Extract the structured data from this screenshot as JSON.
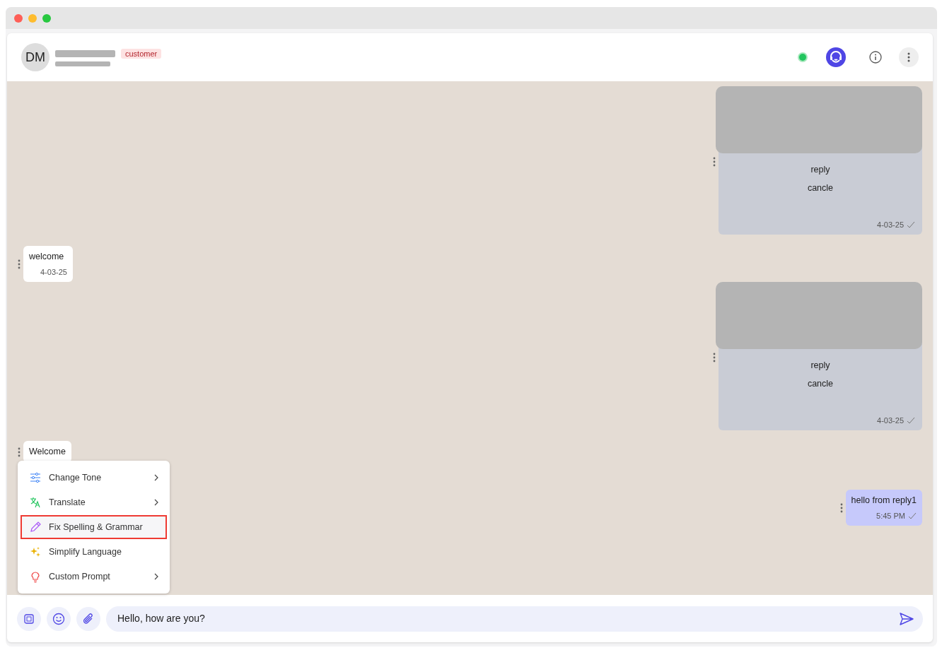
{
  "header": {
    "avatar_initials": "DM",
    "tag": "customer",
    "online": true
  },
  "messages": [
    {
      "kind": "template",
      "outgoing": true,
      "buttons": [
        "reply",
        "cancle"
      ],
      "time": "4-03-25"
    },
    {
      "kind": "text",
      "outgoing": false,
      "text": "welcome",
      "time": "4-03-25"
    },
    {
      "kind": "template",
      "outgoing": true,
      "buttons": [
        "reply",
        "cancle"
      ],
      "time": "4-03-25"
    },
    {
      "kind": "text",
      "outgoing": false,
      "text": "Welcome"
    },
    {
      "kind": "text",
      "outgoing": true,
      "text": "hello from reply1",
      "time": "5:45 PM"
    }
  ],
  "ai_menu": [
    {
      "label": "Change Tone",
      "submenu": true,
      "selected": false
    },
    {
      "label": "Translate",
      "submenu": true,
      "selected": false
    },
    {
      "label": "Fix Spelling & Grammar",
      "submenu": false,
      "selected": true
    },
    {
      "label": "Simplify Language",
      "submenu": false,
      "selected": false
    },
    {
      "label": "Custom Prompt",
      "submenu": true,
      "selected": false
    }
  ],
  "composer": {
    "value": "Hello, how are you?"
  }
}
